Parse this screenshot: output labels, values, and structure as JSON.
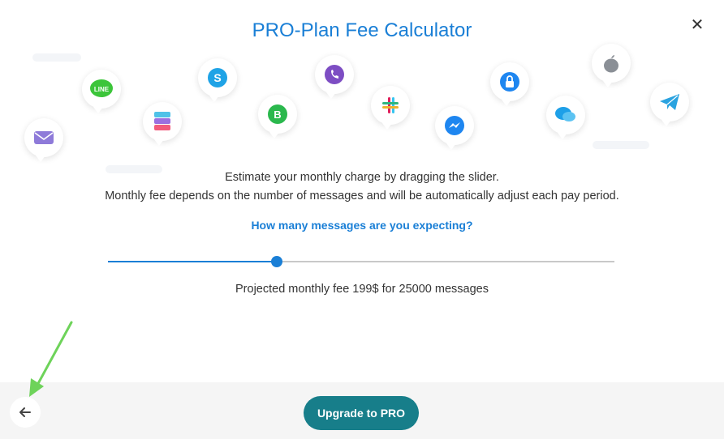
{
  "modal": {
    "title": "PRO-Plan Fee Calculator",
    "close_icon": "close-icon"
  },
  "banner": {
    "icons": [
      "mail-icon",
      "line-icon",
      "stack-icon",
      "skype-icon",
      "whatsapp-business-icon",
      "viber-icon",
      "slack-icon",
      "messenger-icon",
      "lock-icon",
      "chat-icon",
      "apple-icon",
      "telegram-icon"
    ]
  },
  "description": {
    "line1": "Estimate your monthly charge by dragging the slider.",
    "line2": "Monthly fee depends on the number of messages and will be automatically adjust each pay period."
  },
  "question": "How many messages are you expecting?",
  "slider": {
    "value_fraction": 0.334
  },
  "projection": "Projected monthly fee 199$ for 25000 messages",
  "footer": {
    "upgrade_label": "Upgrade to PRO",
    "back_icon": "arrow-left-icon"
  },
  "colors": {
    "accent": "#1a7fd6",
    "button": "#177e8a",
    "annotation_arrow": "#6ed35a"
  }
}
